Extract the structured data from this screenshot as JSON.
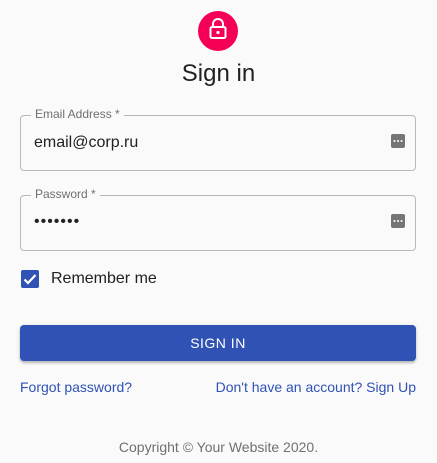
{
  "colors": {
    "avatar_bg": "#f50057",
    "primary": "#3052b4",
    "link": "#3052b4"
  },
  "header": {
    "icon": "lock-icon",
    "title": "Sign in"
  },
  "form": {
    "email": {
      "label": "Email Address *",
      "value": "email@corp.ru",
      "icon": "password-manager-icon"
    },
    "password": {
      "label": "Password *",
      "value": "•••••••",
      "icon": "password-manager-icon"
    },
    "remember": {
      "label": "Remember me",
      "checked": true
    },
    "submit_label": "SIGN IN"
  },
  "links": {
    "forgot": "Forgot password?",
    "signup": "Don't have an account? Sign Up"
  },
  "footer": {
    "copyright": "Copyright © Your Website 2020."
  }
}
